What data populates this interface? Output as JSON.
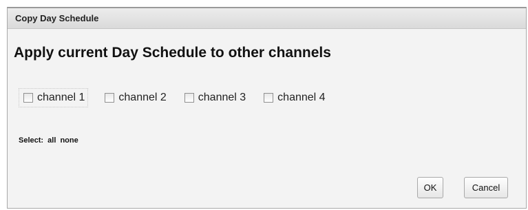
{
  "dialog": {
    "title": "Copy Day Schedule",
    "heading": "Apply current Day Schedule to other channels",
    "channels": [
      {
        "label": "channel 1",
        "checked": false
      },
      {
        "label": "channel 2",
        "checked": false
      },
      {
        "label": "channel 3",
        "checked": false
      },
      {
        "label": "channel 4",
        "checked": false
      }
    ],
    "select": {
      "label": "Select:",
      "all": "all",
      "none": "none"
    },
    "buttons": {
      "ok": "OK",
      "cancel": "Cancel"
    }
  }
}
